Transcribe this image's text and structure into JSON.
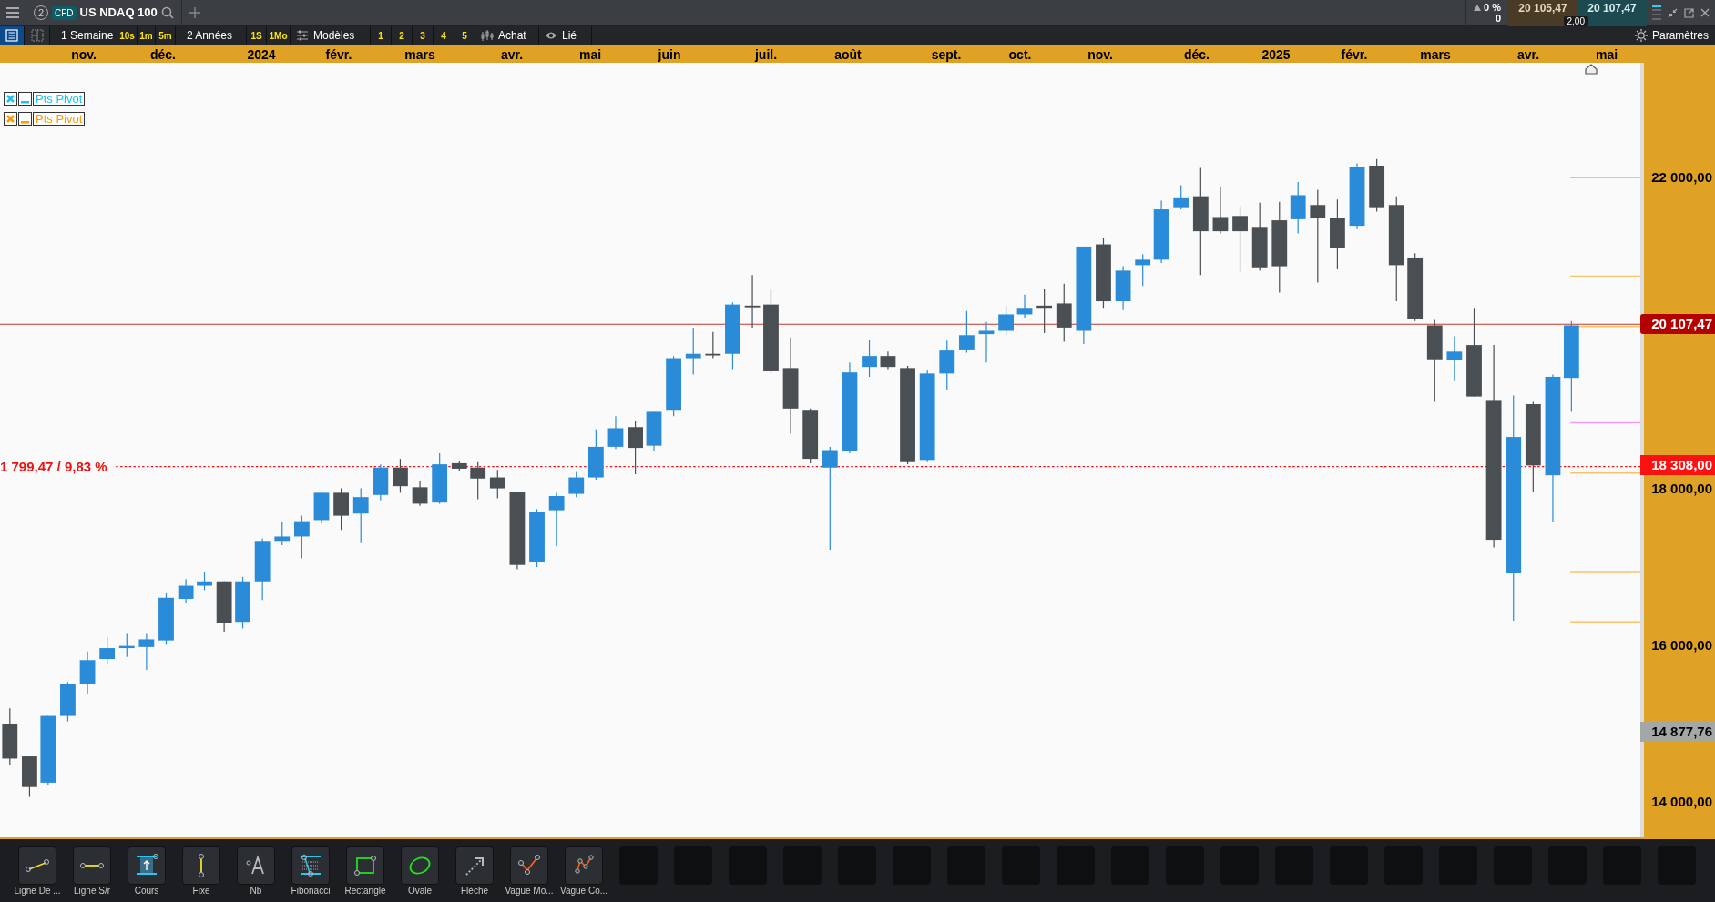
{
  "top_bar": {
    "tab_number": "2",
    "badge": "CFD",
    "instrument": "US NDAQ 100",
    "change": "0 %",
    "change_points": "0",
    "bid": "20 105,47",
    "ask": "20 107,47",
    "spread": "2,00"
  },
  "toolbar": {
    "items": [
      {
        "kind": "icon",
        "selected": true
      },
      {
        "kind": "icon",
        "selected": false
      },
      {
        "kind": "label",
        "label": "1 Semaine"
      },
      {
        "kind": "quick",
        "label": "10s"
      },
      {
        "kind": "quick",
        "label": "1m"
      },
      {
        "kind": "quick",
        "label": "5m"
      },
      {
        "kind": "label",
        "label": "2 Années"
      },
      {
        "kind": "quick",
        "label": "1S"
      },
      {
        "kind": "quick",
        "label": "1Mo"
      },
      {
        "kind": "icon_label",
        "label": "Modèles"
      },
      {
        "kind": "quick",
        "label": "1"
      },
      {
        "kind": "quick",
        "label": "2"
      },
      {
        "kind": "quick",
        "label": "3"
      },
      {
        "kind": "quick",
        "label": "4"
      },
      {
        "kind": "quick",
        "label": "5"
      },
      {
        "kind": "icon_label",
        "label": "Achat"
      },
      {
        "kind": "icon_label",
        "label": "Lié"
      }
    ],
    "settings": "Paramètres"
  },
  "months": [
    "nov.",
    "déc.",
    "2024",
    "févr.",
    "mars",
    "avr.",
    "mai",
    "juin",
    "juil.",
    "août",
    "sept.",
    "oct.",
    "nov.",
    "déc.",
    "2025",
    "févr.",
    "mars",
    "avr.",
    "mai"
  ],
  "legend": [
    {
      "label": "Pts Pivot",
      "color": "#19c3ee"
    },
    {
      "label": "Pts Pivot",
      "color": "#ff9800"
    }
  ],
  "measure_label": "1 799,47 / 9,83 %",
  "price_ticks": [
    "22 000,00",
    "18 000,00",
    "16 000,00",
    "14 000,00"
  ],
  "price_badges": [
    {
      "label": "20 107,47",
      "kind": "current"
    },
    {
      "label": "18 308,00",
      "kind": "alert"
    },
    {
      "label": "14 877,76",
      "kind": "reference"
    }
  ],
  "tools": [
    {
      "label": "Ligne De ..."
    },
    {
      "label": "Ligne S/r"
    },
    {
      "label": "Cours"
    },
    {
      "label": "Fixe"
    },
    {
      "label": "Nb"
    },
    {
      "label": "Fibonacci"
    },
    {
      "label": "Rectangle"
    },
    {
      "label": "Ovale"
    },
    {
      "label": "Flèche"
    },
    {
      "label": "Vague Mo..."
    },
    {
      "label": "Vague Co..."
    }
  ]
}
